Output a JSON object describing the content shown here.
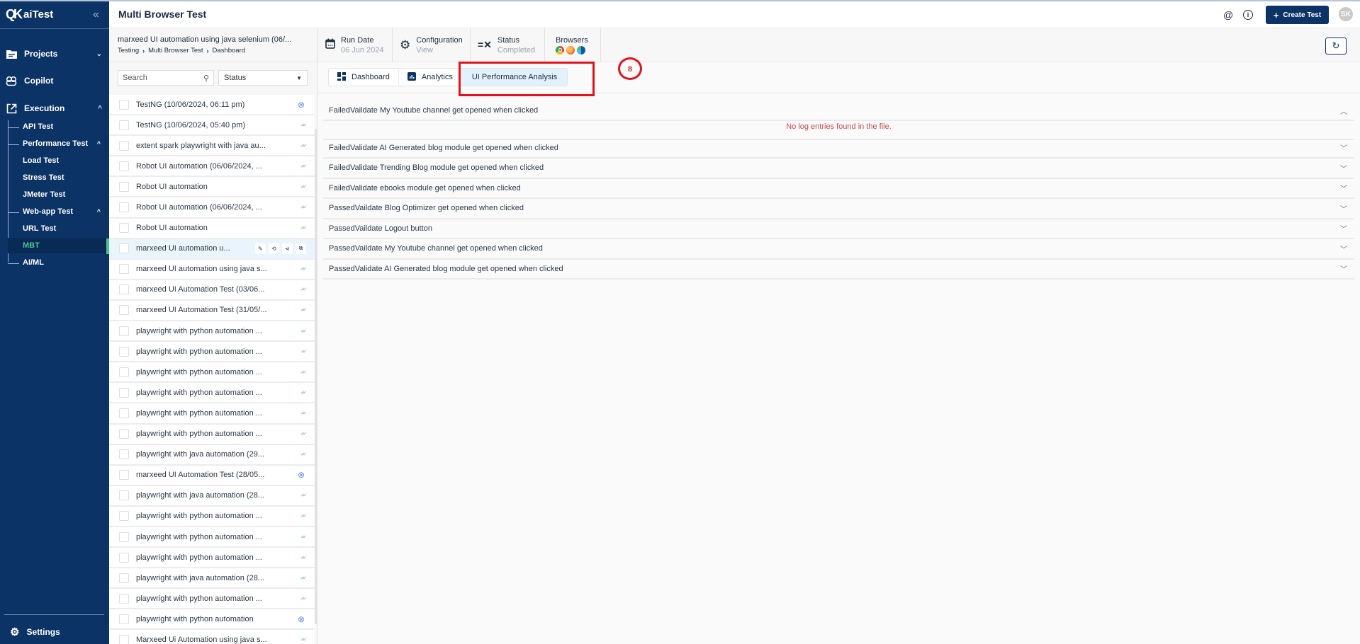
{
  "sidebar": {
    "brand": "aiTest",
    "collapse_icon": "double-chevron-left",
    "nav": [
      {
        "label": "Projects",
        "icon": "folder-icon",
        "expanded": false
      },
      {
        "label": "Copilot",
        "icon": "copilot-icon"
      },
      {
        "label": "Execution",
        "icon": "external-link-icon",
        "expanded": true
      }
    ],
    "execution_children": [
      {
        "label": "API Test"
      },
      {
        "label": "Performance Test",
        "expanded": true,
        "children": [
          "Load Test",
          "Stress Test",
          "JMeter Test"
        ]
      },
      {
        "label": "Web-app Test",
        "expanded": true,
        "children": [
          "URL Test",
          "MBT"
        ]
      },
      {
        "label": "AI/ML"
      }
    ],
    "active_item": "MBT",
    "settings_label": "Settings"
  },
  "topbar": {
    "title": "Multi Browser Test",
    "create_label": "Create Test",
    "avatar_initials": "SK"
  },
  "infobar": {
    "run_title": "marxeed UI automation using java selenium (06/...",
    "breadcrumb": [
      "Testing",
      "Multi Browser Test",
      "Dashboard"
    ],
    "run_date_label": "Run Date",
    "run_date_value": "06 Jun 2024",
    "config_label": "Configuration",
    "config_value": "View",
    "status_label": "Status",
    "status_value": "Completed",
    "browsers_label": "Browsers",
    "browsers": [
      "chrome",
      "firefox",
      "edge"
    ]
  },
  "list": {
    "search_placeholder": "Search",
    "status_placeholder": "Status",
    "rows": [
      {
        "label": "TestNG (10/06/2024, 06:11 pm)",
        "status": "failed"
      },
      {
        "label": "TestNG (10/06/2024, 05:40 pm)",
        "status": "passed"
      },
      {
        "label": "extent spark playwright with java au...",
        "status": "passed"
      },
      {
        "label": "Robot UI automation (06/06/2024, ...",
        "status": "passed"
      },
      {
        "label": "Robot UI automation",
        "status": "passed"
      },
      {
        "label": "Robot UI automation (06/06/2024, ...",
        "status": "passed"
      },
      {
        "label": "Robot UI automation",
        "status": "passed"
      },
      {
        "label": "marxeed UI automation u...",
        "status": "selected"
      },
      {
        "label": "marxeed UI automation using java s...",
        "status": "passed"
      },
      {
        "label": "marxeed UI Automation Test (03/06...",
        "status": "passed"
      },
      {
        "label": "marxeed UI Automation Test (31/05/...",
        "status": "passed"
      },
      {
        "label": "playwright with python automation ...",
        "status": "passed"
      },
      {
        "label": "playwright with python automation ...",
        "status": "passed"
      },
      {
        "label": "playwright with python automation ...",
        "status": "passed"
      },
      {
        "label": "playwright with python automation ...",
        "status": "passed"
      },
      {
        "label": "playwright with python automation ...",
        "status": "passed"
      },
      {
        "label": "playwright with python automation ...",
        "status": "passed"
      },
      {
        "label": "playwright with java automation (29...",
        "status": "passed"
      },
      {
        "label": "marxeed UI Automation Test (28/05...",
        "status": "failed"
      },
      {
        "label": "playwright with java automation (28...",
        "status": "passed"
      },
      {
        "label": "playwright with python automation ...",
        "status": "passed"
      },
      {
        "label": "playwright with python automation ...",
        "status": "passed"
      },
      {
        "label": "playwright with python automation ...",
        "status": "passed"
      },
      {
        "label": "playwright with java automation (28...",
        "status": "passed"
      },
      {
        "label": "playwright with python automation ...",
        "status": "passed"
      },
      {
        "label": "playwright with python automation",
        "status": "failed"
      },
      {
        "label": "Marxeed Ui Automation using java s...",
        "status": "passed"
      }
    ],
    "row_actions": [
      "edit",
      "rerun",
      "share",
      "copy"
    ]
  },
  "tabs": [
    {
      "label": "Dashboard",
      "icon": "dashboard-icon"
    },
    {
      "label": "Analytics",
      "icon": "analytics-icon"
    },
    {
      "label": "UI Performance Analysis",
      "active": true
    }
  ],
  "annotation": {
    "step": "8"
  },
  "results": {
    "empty_message": "No log entries found in the file.",
    "items": [
      {
        "label": "FailedVaildate My Youtube channel get opened when clicked",
        "open": true
      },
      {
        "label": "FailedValidate AI Generated blog module get opened when clicked"
      },
      {
        "label": "FailedValidate Trending Blog module get opened when clicked"
      },
      {
        "label": "FailedValidate ebooks module get opened when clicked"
      },
      {
        "label": "PassedVaildate Blog Optimizer get opened when clicked"
      },
      {
        "label": "PassedVaildate Logout button"
      },
      {
        "label": "PassedVaildate My Youtube channel get opened when clicked"
      },
      {
        "label": "PassedValidate AI Generated blog module get opened when clicked"
      }
    ]
  },
  "colors": {
    "sidebar_bg": "#0b3366",
    "accent_green": "#4fc08d",
    "annotation_red": "#e0141e",
    "error_text": "#c44b4b",
    "pass_check": "#8fce9b",
    "fail_icon": "#5b8ee6"
  }
}
